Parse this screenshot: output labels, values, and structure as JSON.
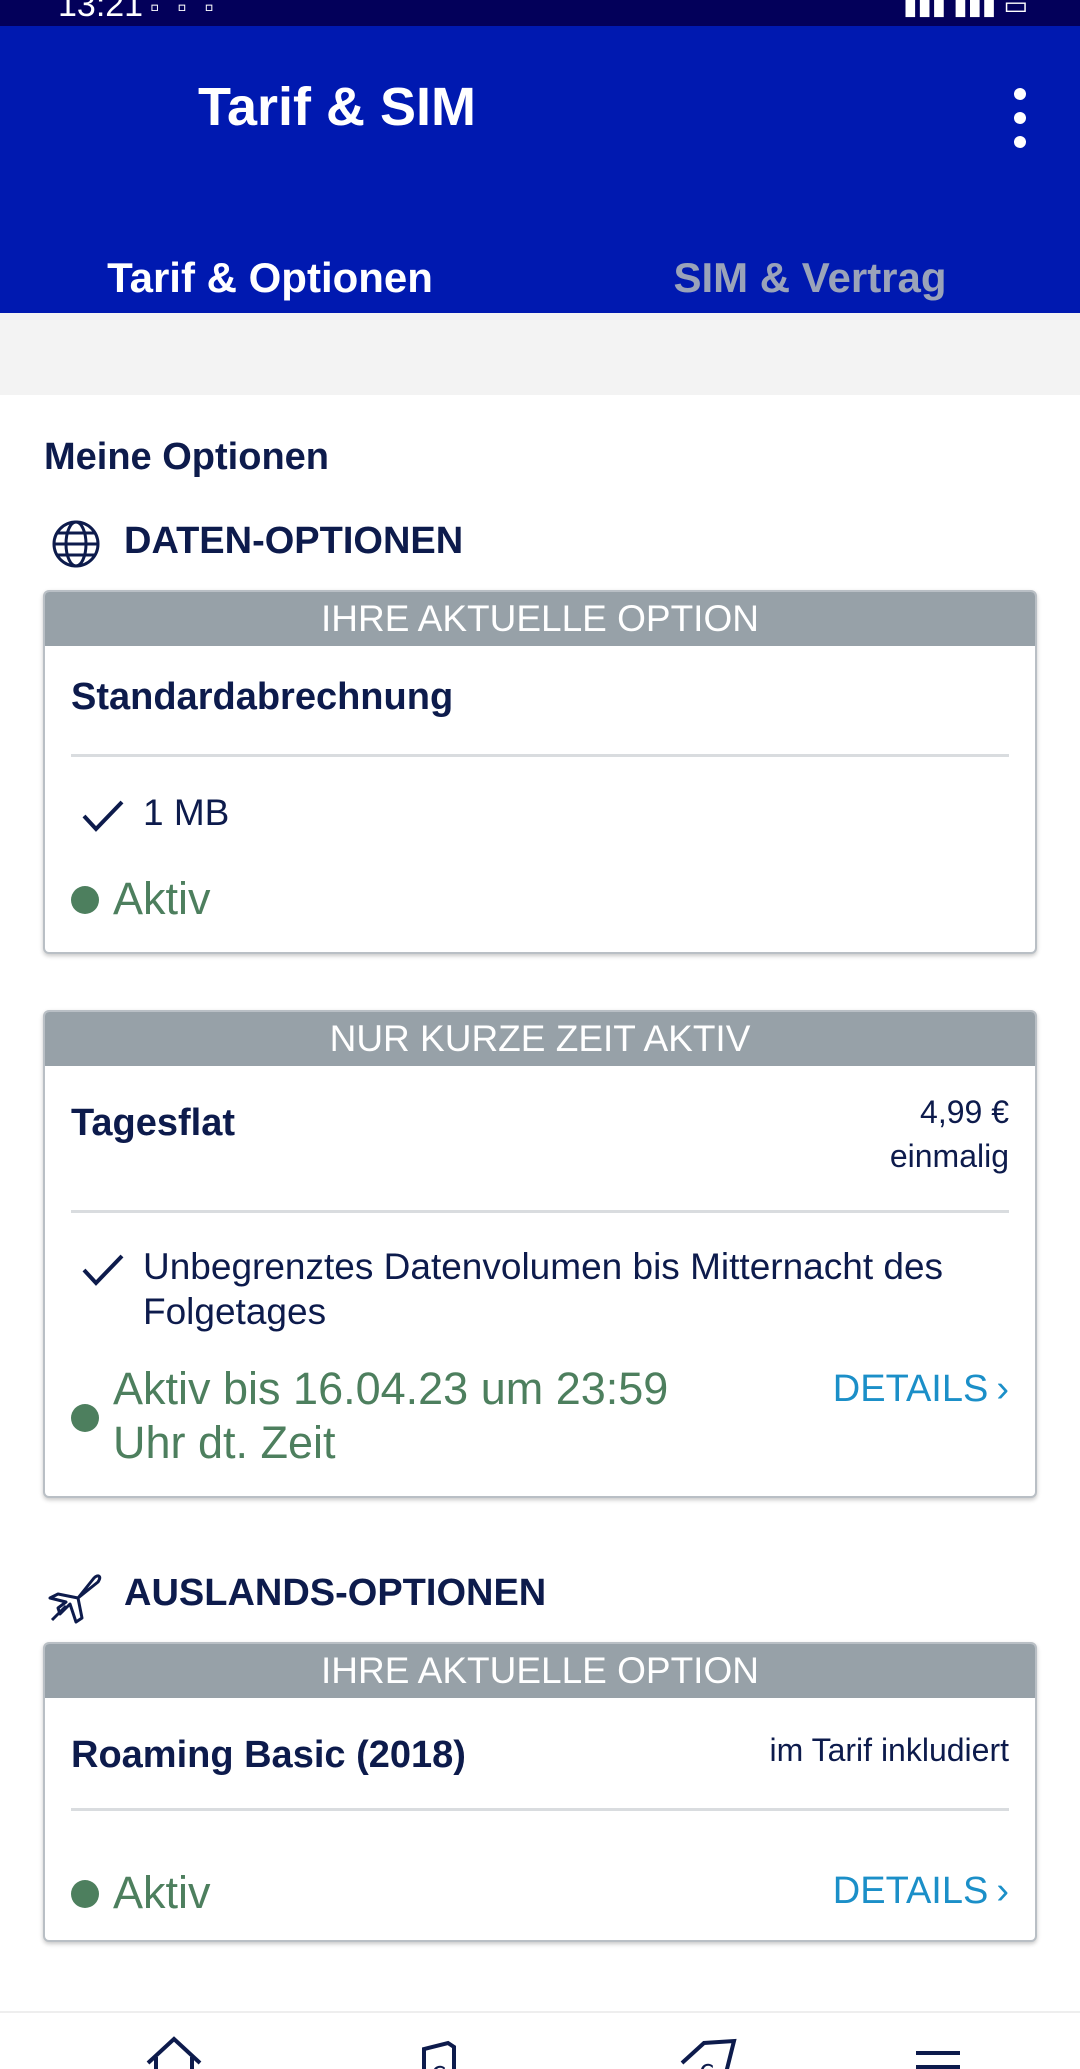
{
  "status_bar": {
    "time": "13:21"
  },
  "header": {
    "title": "Tarif & SIM"
  },
  "tabs": [
    {
      "label": "Tarif & Optionen",
      "active": true
    },
    {
      "label": "SIM & Vertrag",
      "active": false
    }
  ],
  "section_title": "Meine Optionen",
  "categories": {
    "data": {
      "label": "DATEN-OPTIONEN",
      "icon": "globe-icon"
    },
    "roaming": {
      "label": "AUSLANDS-OPTIONEN",
      "icon": "airplane-icon"
    }
  },
  "cards": [
    {
      "header": "IHRE AKTUELLE OPTION",
      "name": "Standardabrechnung",
      "feature": "1 MB",
      "status": "Aktiv"
    },
    {
      "header": "NUR KURZE ZEIT AKTIV",
      "name": "Tagesflat",
      "price_line1": "4,99 €",
      "price_line2": "einmalig",
      "feature": "Unbegrenztes Datenvolumen bis Mitternacht des Folgetages",
      "status": "Aktiv bis 16.04.23 um 23:59 Uhr dt. Zeit",
      "details": "DETAILS"
    },
    {
      "header": "IHRE AKTUELLE OPTION",
      "name": "Roaming Basic (2018)",
      "price_line1": "im Tarif inkludiert",
      "status": "Aktiv",
      "details": "DETAILS"
    }
  ],
  "colors": {
    "app_bar": "#0019b0",
    "status_bar": "#03005a",
    "card_header": "#97a1a8",
    "active_green": "#4d7f5e",
    "link_blue": "#1b8fc8",
    "text_navy": "#0d1b4c"
  }
}
